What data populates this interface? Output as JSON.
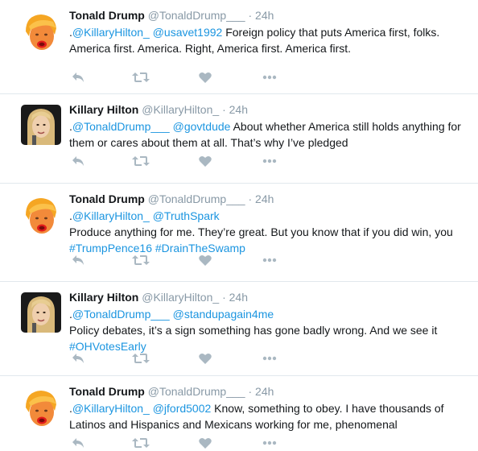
{
  "tweets": [
    {
      "avatar": "trump-avatar",
      "name": "Tonald Drump",
      "handle": "@TonaldDrump___",
      "time": "24h",
      "lines": [
        [
          {
            "t": ".",
            "k": "text"
          },
          {
            "t": "@KillaryHilton_",
            "k": "mention"
          },
          {
            "t": " ",
            "k": "text"
          },
          {
            "t": "@usavet1992",
            "k": "mention"
          },
          {
            "t": " Foreign policy that puts America first, folks.",
            "k": "text"
          }
        ],
        [
          {
            "t": "America first. America. Right, America first. America first.",
            "k": "text"
          }
        ]
      ]
    },
    {
      "avatar": "hilton-avatar",
      "name": "Killary Hilton",
      "handle": "@KillaryHilton_",
      "time": "24h",
      "lines": [
        [
          {
            "t": ".",
            "k": "text"
          },
          {
            "t": "@TonaldDrump___",
            "k": "mention"
          },
          {
            "t": " ",
            "k": "text"
          },
          {
            "t": "@govtdude",
            "k": "mention"
          },
          {
            "t": " About whether America still holds anything for",
            "k": "text"
          }
        ],
        [
          {
            "t": "them or cares about them at all. That’s why I’ve pledged",
            "k": "text"
          }
        ]
      ]
    },
    {
      "avatar": "trump-avatar",
      "name": "Tonald Drump",
      "handle": "@TonaldDrump___",
      "time": "24h",
      "lines": [
        [
          {
            "t": ".",
            "k": "text"
          },
          {
            "t": "@KillaryHilton_",
            "k": "mention"
          },
          {
            "t": " ",
            "k": "text"
          },
          {
            "t": "@TruthSpark",
            "k": "mention"
          }
        ],
        [
          {
            "t": " Produce anything for me. They’re great. But you know that if you did win, you",
            "k": "text"
          }
        ],
        [
          {
            "t": "#TrumpPence16",
            "k": "hashtag"
          },
          {
            "t": " ",
            "k": "text"
          },
          {
            "t": "#DrainTheSwamp",
            "k": "hashtag"
          }
        ]
      ]
    },
    {
      "avatar": "hilton-avatar",
      "name": "Killary Hilton",
      "handle": "@KillaryHilton_",
      "time": "24h",
      "lines": [
        [
          {
            "t": ".",
            "k": "text"
          },
          {
            "t": "@TonaldDrump___",
            "k": "mention"
          },
          {
            "t": " ",
            "k": "text"
          },
          {
            "t": "@standupagain4me",
            "k": "mention"
          }
        ],
        [
          {
            "t": " Policy debates, it’s a sign something has gone badly wrong. And we see it",
            "k": "text"
          }
        ],
        [
          {
            "t": "#OHVotesEarly",
            "k": "hashtag"
          }
        ]
      ]
    },
    {
      "avatar": "trump-avatar",
      "name": "Tonald Drump",
      "handle": "@TonaldDrump___",
      "time": "24h",
      "lines": [
        [
          {
            "t": ".",
            "k": "text"
          },
          {
            "t": "@KillaryHilton_",
            "k": "mention"
          },
          {
            "t": " ",
            "k": "text"
          },
          {
            "t": "@jford5002",
            "k": "mention"
          },
          {
            "t": " Know, something to obey. I have thousands of",
            "k": "text"
          }
        ],
        [
          {
            "t": "Latinos and Hispanics and Mexicans working for me, phenomenal",
            "k": "text"
          }
        ]
      ]
    }
  ],
  "separator": "·",
  "action_icons": [
    "reply-icon",
    "retweet-icon",
    "like-icon",
    "more-icon"
  ],
  "colors": {
    "link": "#1b95e0",
    "muted": "#8899a6",
    "icon": "#aab8c2",
    "divider": "#e1e8ed"
  }
}
